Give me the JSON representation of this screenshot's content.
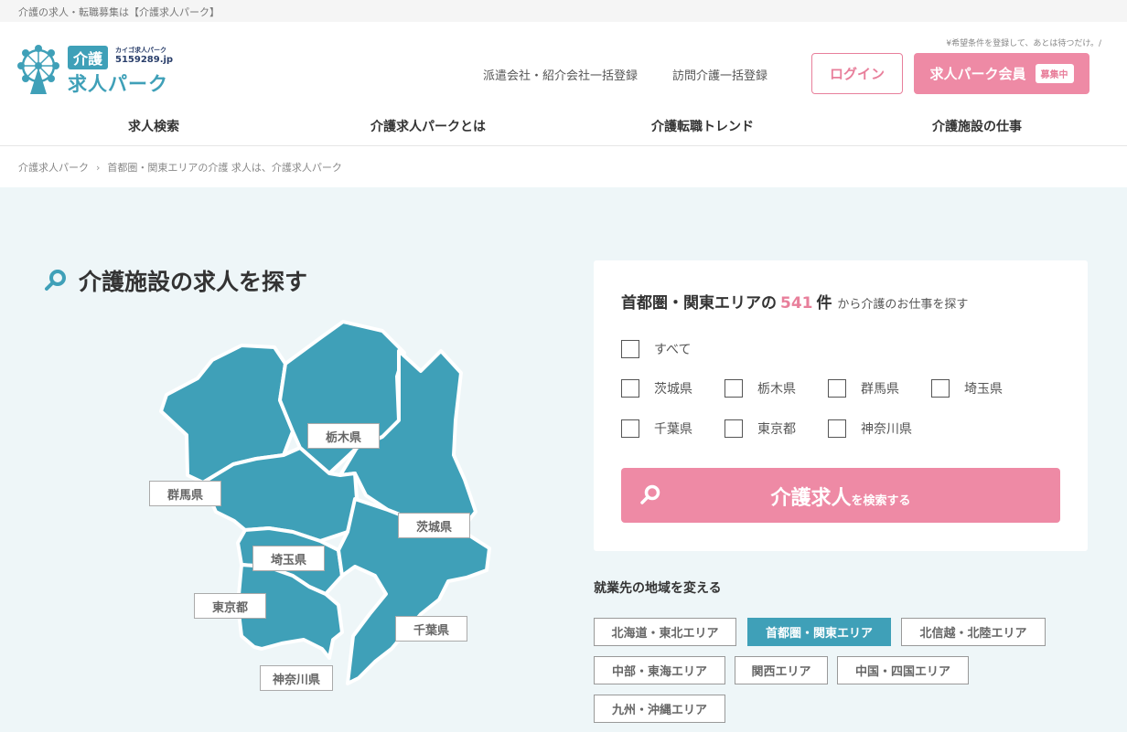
{
  "topbar": {
    "text": "介護の求人・転職募集は【介護求人パーク】"
  },
  "logo": {
    "badge": "介護",
    "kana": "カイゴ求人パーク",
    "number": "5159289.jp",
    "name": "求人パーク"
  },
  "header": {
    "tagline": "¥希望条件を登録して、あとは待つだけ。/",
    "link_dispatch": "派遣会社・紹介会社一括登録",
    "link_visit": "訪問介護一括登録",
    "login_label": "ログイン",
    "member_label": "求人パーク会員",
    "member_badge": "募集中"
  },
  "nav": {
    "items": [
      {
        "label": "求人検索"
      },
      {
        "label": "介護求人パークとは"
      },
      {
        "label": "介護転職トレンド"
      },
      {
        "label": "介護施設の仕事"
      }
    ]
  },
  "breadcrumb": {
    "home": "介護求人パーク",
    "current": "首都圏・関東エリアの介護 求人は、介護求人パーク"
  },
  "search_section": {
    "title": "介護施設の求人を探す",
    "map_labels": {
      "tochigi": "栃木県",
      "gunma": "群馬県",
      "ibaraki": "茨城県",
      "saitama": "埼玉県",
      "tokyo": "東京都",
      "chiba": "千葉県",
      "kanagawa": "神奈川県"
    },
    "map_color": "#3fa0b8"
  },
  "search_card": {
    "area": "首都圏・関東エリアの",
    "count": "541",
    "unit": "件",
    "suffix": "から介護のお仕事を探す",
    "all_label": "すべて",
    "prefectures": [
      "茨城県",
      "栃木県",
      "群馬県",
      "埼玉県",
      "千葉県",
      "東京都",
      "神奈川県"
    ],
    "button_main": "介護求人",
    "button_sub": "を検索する"
  },
  "regions": {
    "title": "就業先の地域を変える",
    "items": [
      "北海道・東北エリア",
      "首都圏・関東エリア",
      "北信越・北陸エリア",
      "中部・東海エリア",
      "関西エリア",
      "中国・四国エリア",
      "九州・沖縄エリア"
    ],
    "active": "首都圏・関東エリア"
  },
  "colors": {
    "accent_pink": "#ee8aa5",
    "accent_teal": "#3fa0b8",
    "bg": "#eef6f8"
  }
}
